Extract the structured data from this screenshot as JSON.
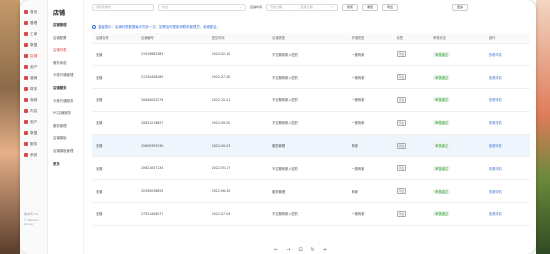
{
  "nav": {
    "items": [
      "首页",
      "管理",
      "工单",
      "数据",
      "店铺",
      "用户",
      "营销",
      "财务",
      "商城",
      "内容",
      "用户",
      "数据",
      "服务",
      "系统"
    ],
    "active": 4,
    "footer": [
      "版本号 V3",
      "© Minami Group"
    ]
  },
  "sub": {
    "title": "店铺",
    "items": [
      {
        "label": "店铺管理",
        "group": true
      },
      {
        "label": "店铺配置",
        "group": false
      },
      {
        "label": "店铺列表",
        "group": false,
        "active": true
      },
      {
        "label": "服务承诺",
        "group": false
      },
      {
        "label": "卡券开通管理",
        "group": false
      },
      {
        "label": "店铺服务",
        "group": true
      },
      {
        "label": "卡券开通服务",
        "group": false
      },
      {
        "label": "PC店铺服务",
        "group": false
      },
      {
        "label": "服务管理",
        "group": false
      },
      {
        "label": "店铺模板",
        "group": false
      },
      {
        "label": "店铺模板管理",
        "group": false
      },
      {
        "label": "更多",
        "group": true
      }
    ]
  },
  "toolbar": {
    "search_placeholder": "请搜索编号",
    "status_placeholder": "状态",
    "date_label": "店铺时间",
    "date_start": "开始日期",
    "date_end": "结束日期",
    "search_btn": "搜索",
    "reset_btn": "重置",
    "export_btn": "导出",
    "more_btn": "更多"
  },
  "tip": "温馨提示：店铺列表数据每天同步一次，如需及时更新请联系管理员，谢谢配合。",
  "table": {
    "headers": [
      "店铺名称",
      "店铺编号",
      "提交时间",
      "店铺类型",
      "开通类型",
      "标签",
      "审核状态",
      "操作"
    ],
    "rows": [
      {
        "name": "无锡",
        "id": "21910682383",
        "time": "2022-02-10",
        "type": "不过期商家入驻的",
        "open": "一般商家",
        "tag": "平台",
        "status": "审核通过",
        "action": "查看详情"
      },
      {
        "name": "无锡",
        "id": "21234408265",
        "time": "2022-07-20",
        "type": "不过期商家入驻的",
        "open": "一般商家",
        "tag": "平台",
        "status": "审核通过",
        "action": "查看详情"
      },
      {
        "name": "无锡",
        "id": "20640002279",
        "time": "2022-10-21",
        "type": "不过期商家入驻的",
        "open": "一般商家",
        "tag": "平台",
        "status": "审核通过",
        "action": "查看详情"
      },
      {
        "name": "无锡",
        "id": "20831219827",
        "time": "2022-09-20",
        "type": "不过期商家入驻的",
        "open": "一般商家",
        "tag": "平台",
        "status": "审核通过",
        "action": "查看详情"
      },
      {
        "name": "无锡",
        "id": "20609359330",
        "time": "2022-09-23",
        "type": "服务管理",
        "open": "商家",
        "tag": "平台",
        "status": "审核通过",
        "action": "查看详情"
      },
      {
        "name": "无锡",
        "id": "20621007134",
        "time": "2022-05-17",
        "type": "不过期商家入驻的",
        "open": "一般商家",
        "tag": "平台",
        "status": "审核通过",
        "action": "查看详情"
      },
      {
        "name": "无锡",
        "id": "20390036855",
        "time": "2022-06-30",
        "type": "服务管理",
        "open": "商家",
        "tag": "平台",
        "status": "审核通过",
        "action": "查看详情"
      },
      {
        "name": "无锡",
        "id": "27521406577",
        "time": "2022-07-04",
        "type": "不过期商家入驻的",
        "open": "一般商家",
        "tag": "平台",
        "status": "审核通过",
        "action": "查看详情"
      }
    ],
    "highlight_row": 4
  },
  "pager": [
    "←",
    "→",
    "⊡",
    "↻",
    "+"
  ],
  "colors": {
    "accent": "#d84a4a",
    "link": "#3a6fd8",
    "success": "#3a9a3a"
  }
}
